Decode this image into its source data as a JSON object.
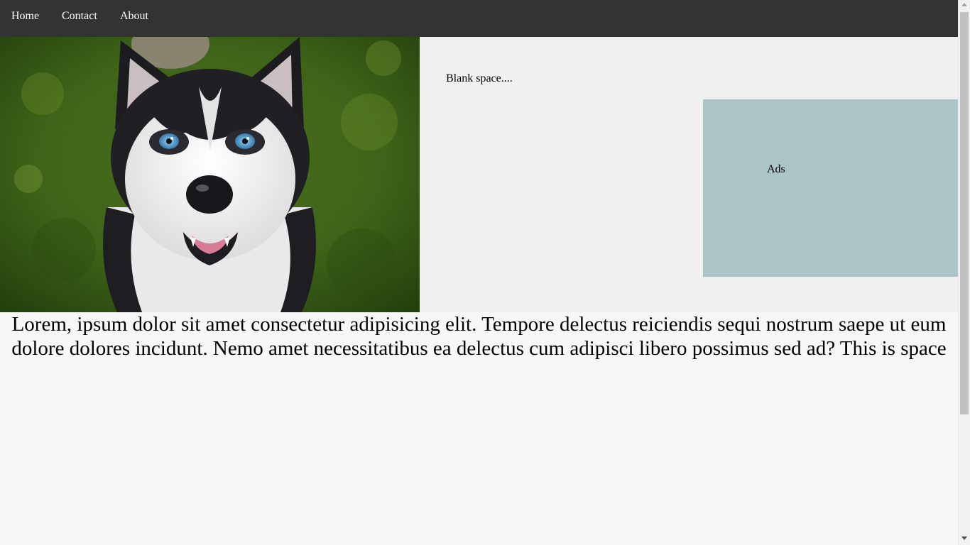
{
  "nav": {
    "items": [
      {
        "label": "Home"
      },
      {
        "label": "Contact"
      },
      {
        "label": "About"
      }
    ],
    "background": "#333333"
  },
  "hero": {
    "image": "husky-dog-photo"
  },
  "sidebar": {
    "blank_text": "Blank space....",
    "ads_label": "Ads",
    "ads_color": "#aac4c7"
  },
  "content": {
    "paragraph": "Lorem, ipsum dolor sit amet consectetur adipisicing elit. Tempore delectus reiciendis sequi nostrum saepe ut eum dolore dolores incidunt. Nemo amet necessitatibus ea delectus cum adipisci libero possimus sed ad? This is space"
  }
}
